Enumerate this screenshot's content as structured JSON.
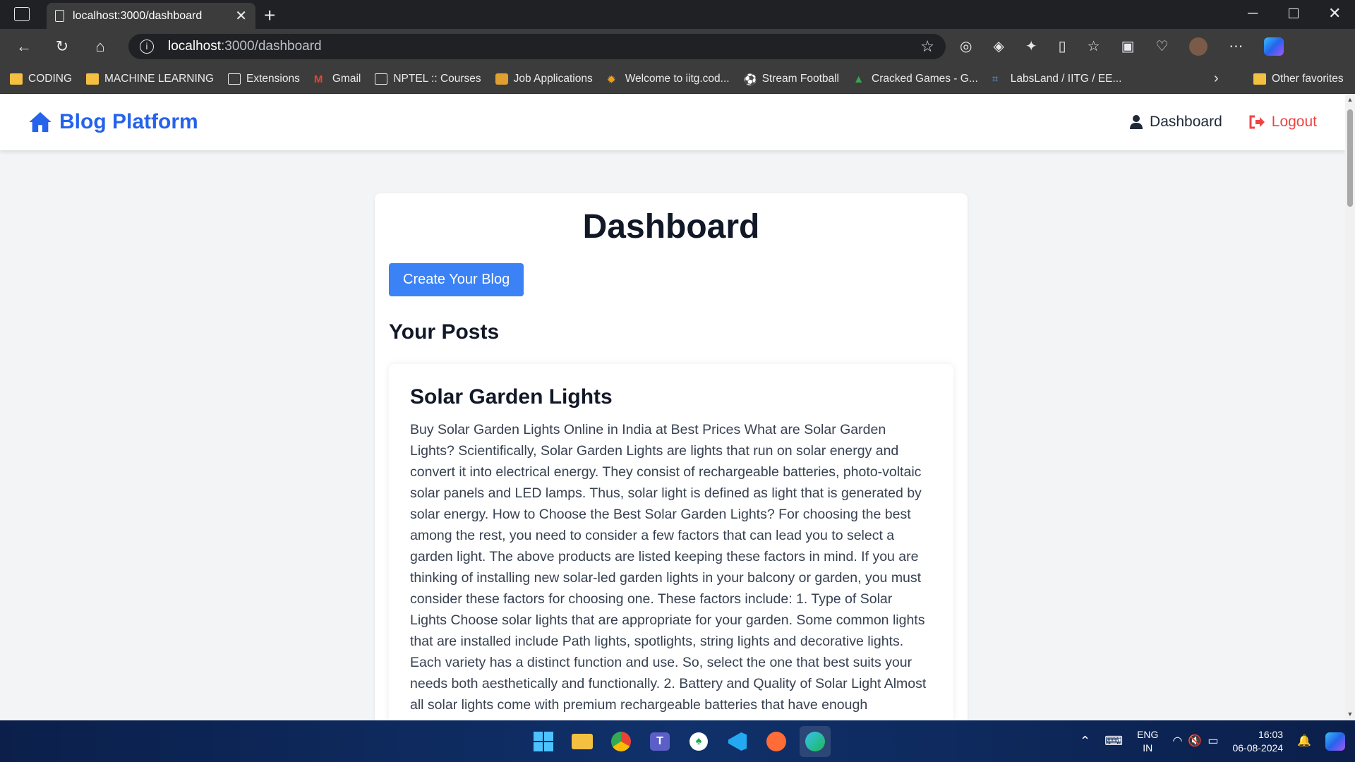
{
  "browser": {
    "tab_title": "localhost:3000/dashboard",
    "url_host": "localhost",
    "url_path": ":3000/dashboard",
    "bookmarks": [
      {
        "label": "CODING",
        "icon": "folder-icon"
      },
      {
        "label": "MACHINE LEARNING",
        "icon": "folder-icon"
      },
      {
        "label": "Extensions",
        "icon": "page-icon"
      },
      {
        "label": "Gmail",
        "icon": "gmail-icon"
      },
      {
        "label": "NPTEL :: Courses",
        "icon": "page-icon"
      },
      {
        "label": "Job Applications",
        "icon": "app-icon"
      },
      {
        "label": "Welcome to iitg.cod...",
        "icon": "sun-icon"
      },
      {
        "label": "Stream Football",
        "icon": "football-icon"
      },
      {
        "label": "Cracked Games - G...",
        "icon": "drive-icon"
      },
      {
        "label": "LabsLand / IITG / EE...",
        "icon": "lab-icon"
      }
    ],
    "other_favorites": "Other favorites"
  },
  "app": {
    "brand": "Blog Platform",
    "nav_dashboard": "Dashboard",
    "nav_logout": "Logout",
    "brand_color": "#2563eb",
    "logout_color": "#ef4444"
  },
  "dashboard": {
    "title": "Dashboard",
    "create_button": "Create Your Blog",
    "posts_heading": "Your Posts",
    "posts": [
      {
        "title": "Solar Garden Lights",
        "body": "Buy Solar Garden Lights Online in India at Best Prices What are Solar Garden Lights? Scientifically, Solar Garden Lights are lights that run on solar energy and convert it into electrical energy. They consist of rechargeable batteries, photo-voltaic solar panels and LED lamps. Thus, solar light is defined as light that is generated by solar energy. How to Choose the Best Solar Garden Lights? For choosing the best among the rest, you need to consider a few factors that can lead you to select a garden light. The above products are listed keeping these factors in mind. If you are thinking of installing new solar-led garden lights in your balcony or garden, you must consider these factors for choosing one. These factors include: 1. Type of Solar Lights Choose solar lights that are appropriate for your garden. Some common lights that are installed include Path lights, spotlights, string lights and decorative lights. Each variety has a distinct function and use. So, select the one that best suits your needs both aesthetically and functionally. 2. Battery and Quality of Solar Light Almost all solar lights come with premium rechargeable batteries that have enough"
      }
    ]
  },
  "taskbar": {
    "lang_top": "ENG",
    "lang_bottom": "IN",
    "time": "16:03",
    "date": "06-08-2024"
  }
}
